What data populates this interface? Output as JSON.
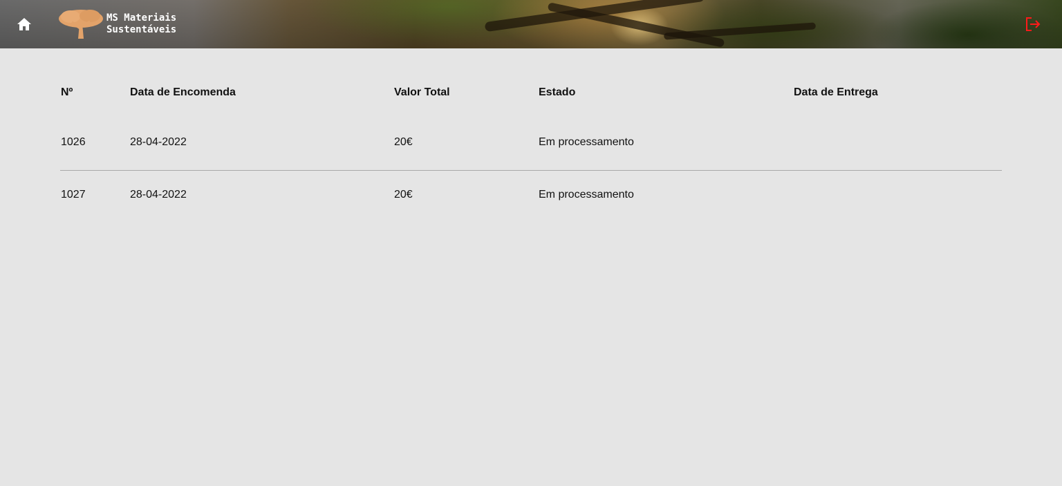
{
  "header": {
    "brand_line1": "MS Materiais",
    "brand_line2": "Sustentáveis",
    "logo_color": "#e3a36a",
    "logout_color": "#ff1a1a",
    "icons": {
      "home": "home-icon",
      "logo": "tree-logo-icon",
      "logout": "logout-icon"
    }
  },
  "orders": {
    "columns": [
      "Nº",
      "Data de Encomenda",
      "Valor Total",
      "Estado",
      "Data de Entrega"
    ],
    "rows": [
      {
        "number": "1026",
        "order_date": "28-04-2022",
        "total": "20€",
        "status": "Em processamento",
        "delivery_date": ""
      },
      {
        "number": "1027",
        "order_date": "28-04-2022",
        "total": "20€",
        "status": "Em processamento",
        "delivery_date": ""
      }
    ]
  }
}
